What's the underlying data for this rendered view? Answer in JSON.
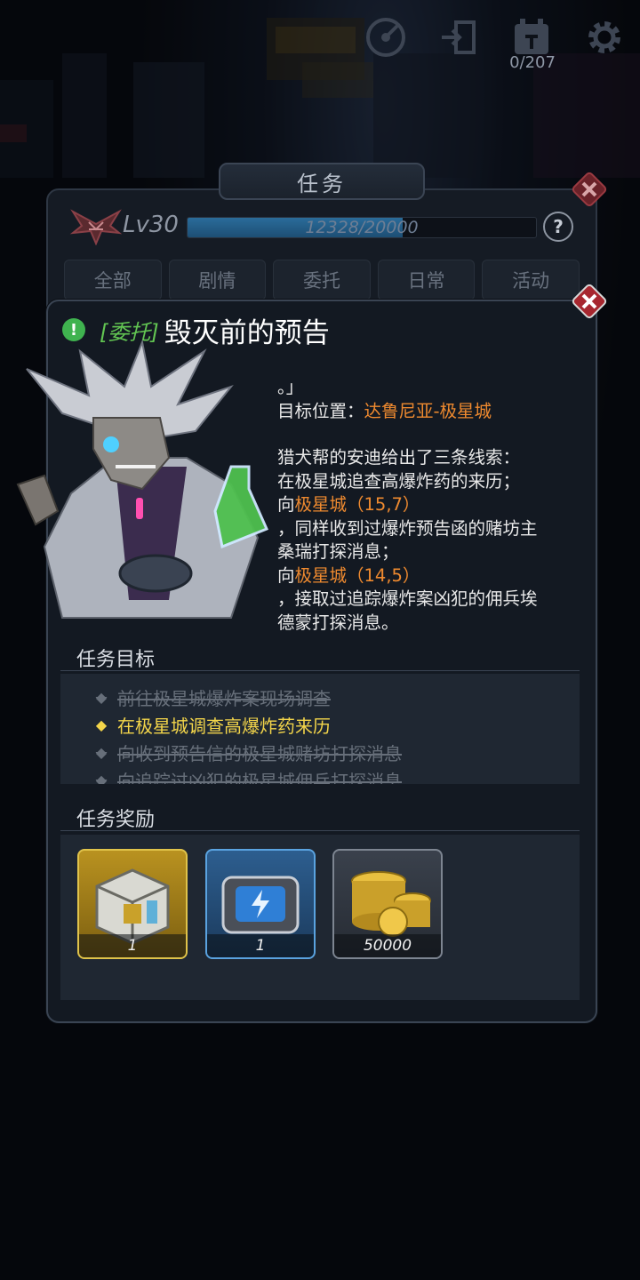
{
  "hud": {
    "icons": [
      "radar-icon",
      "exit-door-icon",
      "calendar-icon",
      "gear-icon"
    ],
    "counter": "0/207"
  },
  "window": {
    "title": "任务",
    "level": "Lv30",
    "xp_text": "12328/20000",
    "xp_fraction": 0.6164,
    "help": "?"
  },
  "tabs": [
    {
      "label": "全部",
      "active": true
    },
    {
      "label": "剧情",
      "active": false
    },
    {
      "label": "委托",
      "active": false
    },
    {
      "label": "日常",
      "active": false
    },
    {
      "label": "活动",
      "active": false
    }
  ],
  "detail": {
    "tag": "[委托]",
    "name": "毁灭前的预告",
    "description": {
      "line0": "。」",
      "target_label": "目标位置：",
      "target_value": "达鲁尼亚-极星城",
      "line2": "猎犬帮的安迪给出了三条线索：",
      "line3": "在极星城追查高爆炸药的来历；",
      "line4_prefix": "向",
      "line4_place": "极星城（15,7）",
      "line5": "，同样收到过爆炸预告函的赌坊主",
      "line6": "桑瑞打探消息；",
      "line7_prefix": "向",
      "line7_place": "极星城（14,5）",
      "line8": "，接取过追踪爆炸案凶犯的佣兵埃",
      "line9": "德蒙打探消息。"
    },
    "objectives_title": "任务目标",
    "objectives": [
      {
        "text": "前往极星城爆炸案现场调查",
        "state": "done"
      },
      {
        "text": "在极星城调查高爆炸药来历",
        "state": "current"
      },
      {
        "text": "向收到预告信的极星城赌坊打探消息",
        "state": "done"
      },
      {
        "text": "向追踪过凶犯的极星城佣兵打探消息",
        "state": "done"
      }
    ],
    "rewards_title": "任务奖励",
    "rewards": [
      {
        "item": "supply-crate-icon",
        "count": "1",
        "rarity_color": "#c9a227"
      },
      {
        "item": "energy-case-icon",
        "count": "1",
        "rarity_color": "#3d7fc0"
      },
      {
        "item": "gold-coins-icon",
        "count": "50000",
        "rarity_color": "#6b7380"
      }
    ]
  },
  "colors": {
    "accent_gold": "#e8b525",
    "highlight_orange": "#ef8a2f",
    "current_objective": "#f3d54a",
    "quest_tag_green": "#62c552",
    "close_red": "#b3323a"
  }
}
